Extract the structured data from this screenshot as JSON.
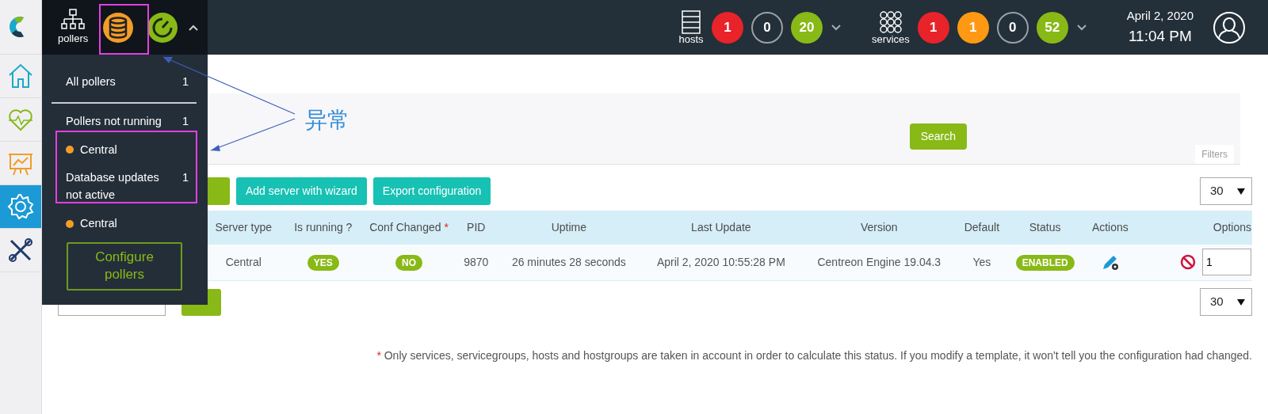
{
  "sidebar": {
    "logo": {
      "kind": "logo"
    },
    "items": [
      {
        "kind": "home",
        "selected": false
      },
      {
        "kind": "monitoring",
        "selected": false
      },
      {
        "kind": "reporting",
        "selected": false
      },
      {
        "kind": "configuration",
        "selected": true
      },
      {
        "kind": "administration",
        "selected": false
      }
    ]
  },
  "top_bar": {
    "hosts": {
      "label": "hosts",
      "counters": [
        {
          "value": "1",
          "color": "#e8232a",
          "kind": "filled"
        },
        {
          "value": "0",
          "color": "#9aa0a6",
          "kind": "outline"
        },
        {
          "value": "20",
          "color": "#88b917",
          "kind": "filled"
        }
      ]
    },
    "services": {
      "label": "services",
      "counters": [
        {
          "value": "1",
          "color": "#e8232a",
          "kind": "filled"
        },
        {
          "value": "1",
          "color": "#ff9913",
          "kind": "filled"
        },
        {
          "value": "0",
          "color": "#9aa0a6",
          "kind": "outline"
        },
        {
          "value": "52",
          "color": "#88b917",
          "kind": "filled"
        }
      ]
    },
    "date": "April 2, 2020",
    "time": "11:04 PM"
  },
  "pollers_menu": {
    "label": "pollers",
    "status_icons": [
      {
        "kind": "database",
        "color": "#f39c27"
      },
      {
        "kind": "broker",
        "color": "#88b917"
      }
    ],
    "expanded": true,
    "items": [
      {
        "kind": "count",
        "label": "All pollers",
        "count": "1"
      },
      {
        "kind": "divider"
      },
      {
        "kind": "count",
        "label": "Pollers not running",
        "count": "1"
      },
      {
        "kind": "poller",
        "label": "Central",
        "color": "#f39c27"
      },
      {
        "kind": "count",
        "label": "Database updates not active",
        "count": "1"
      },
      {
        "kind": "poller",
        "label": "Central",
        "color": "#f39c27"
      }
    ],
    "button": "Configure pollers"
  },
  "annotation": {
    "label": "异常"
  },
  "filters": {
    "search_button": "Search",
    "tab": "Filters"
  },
  "toolbar": {
    "buttons": [
      "Add server with wizard",
      "Export configuration"
    ],
    "page_size": "30"
  },
  "table": {
    "columns": [
      {
        "label": "Server type"
      },
      {
        "label": "Is running ?"
      },
      {
        "label": "Conf Changed",
        "mark": "*"
      },
      {
        "label": "PID"
      },
      {
        "label": "Uptime"
      },
      {
        "label": "Last Update"
      },
      {
        "label": "Version"
      },
      {
        "label": "Default"
      },
      {
        "label": "Status"
      },
      {
        "label": "Actions"
      },
      {
        "label": "Options"
      }
    ],
    "rows": [
      {
        "server_type": "Central",
        "is_running": "YES",
        "conf_changed": "NO",
        "pid": "9870",
        "uptime": "26 minutes 28 seconds",
        "last_update": "April 2, 2020 10:55:28 PM",
        "version": "Centreon Engine 19.04.3",
        "default": "Yes",
        "status": "ENABLED",
        "options_value": "1"
      }
    ]
  },
  "bottom_toolbar": {
    "page_size": "30"
  },
  "footnote": {
    "mark": "*",
    "text": "Only services, servicegroups, hosts and hostgroups are taken in account in order to calculate this status. If you modify a template, it won't tell you the configuration had changed."
  }
}
